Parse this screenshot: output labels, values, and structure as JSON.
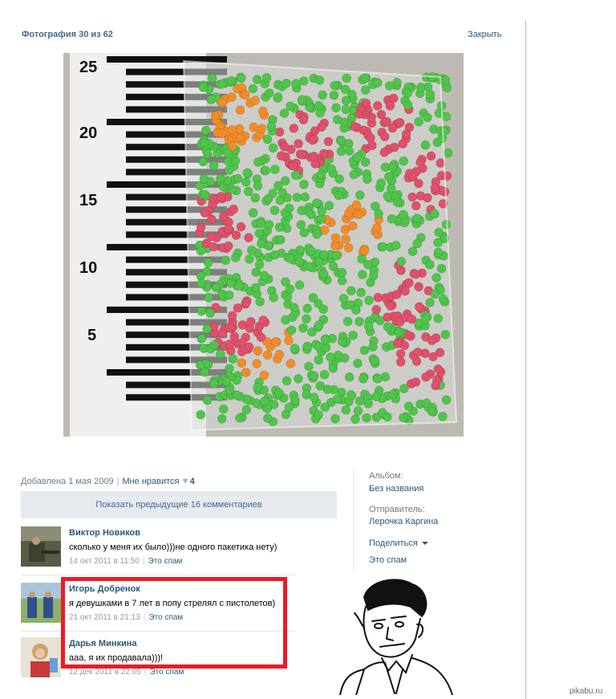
{
  "header": {
    "title": "Фотография 30 из 62",
    "close_label": "Закрыть"
  },
  "photo": {
    "ruler_numbers": [
      "25",
      "20",
      "15",
      "10",
      "5"
    ]
  },
  "meta": {
    "added": "Добавлена 1 мая 2009",
    "like_label": "Мне нравится",
    "like_count": "4"
  },
  "show_previous": "Показать предыдущие 16 комментариев",
  "comments": [
    {
      "author": "Виктор Новиков",
      "text": "сколько у меня их было)))не одного пакетика нету)",
      "date": "14 окт 2011 в 11:50",
      "spam": "Это спам"
    },
    {
      "author": "Игорь Добренок",
      "text": "я девушками в 7 лет в попу стрелял с пистолетов)",
      "date": "21 окт 2011 в 21:13",
      "spam": "Это спам"
    },
    {
      "author": "Дарья Минкина",
      "text": "ааа, я их продавала)))!",
      "date": "12 дек 2011 в 22:05",
      "spam": "Это спам"
    }
  ],
  "sidebar": {
    "album_label": "Альбом:",
    "album_value": "Без названия",
    "sender_label": "Отправитель:",
    "sender_value": "Лерочка Каргина",
    "share_label": "Поделиться",
    "spam_label": "Это спам"
  },
  "watermark": "pikabu.ru",
  "colors": {
    "link": "#2b587a",
    "highlight": "#ea1c24",
    "panel": "#e7eaef"
  }
}
